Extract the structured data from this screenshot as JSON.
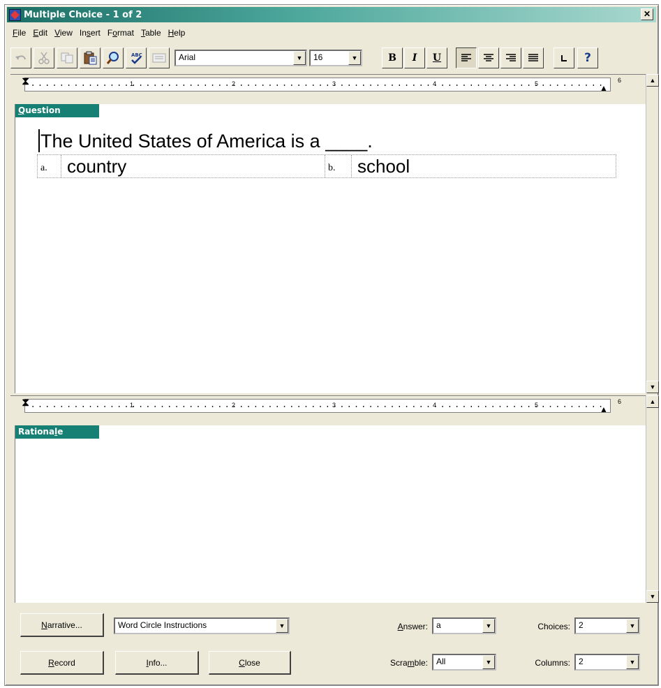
{
  "window": {
    "title": "Multiple Choice - 1 of 2",
    "close_glyph": "✕"
  },
  "menu": {
    "items": [
      {
        "ul": "F",
        "rest": "ile"
      },
      {
        "ul": "E",
        "rest": "dit"
      },
      {
        "ul": "V",
        "rest": "iew"
      },
      {
        "pre": "In",
        "ul": "s",
        "rest": "ert"
      },
      {
        "pre": "F",
        "ul": "o",
        "rest": "rmat"
      },
      {
        "ul": "T",
        "rest": "able"
      },
      {
        "ul": "H",
        "rest": "elp"
      }
    ]
  },
  "toolbar": {
    "font_name": "Arial",
    "font_size": "16",
    "bold": "B",
    "italic": "I",
    "underline": "U",
    "help": "?",
    "icons": [
      "undo-icon",
      "cut-icon",
      "copy-icon",
      "paste-icon",
      "find-icon",
      "spellcheck-icon",
      "insert-icon"
    ]
  },
  "ruler": {
    "numbers": [
      "1",
      "2",
      "3",
      "4",
      "5",
      "6"
    ]
  },
  "question": {
    "section_label_ul": "Q",
    "section_label_rest": "uestion",
    "text": "The United States of America is a ____.",
    "choices": [
      {
        "letter": "a.",
        "text": "country"
      },
      {
        "letter": "b.",
        "text": "school"
      }
    ]
  },
  "rationale": {
    "section_label_pre": "Rationa",
    "section_label_ul": "l",
    "section_label_rest": "e"
  },
  "controls": {
    "narrative_ul": "N",
    "narrative_rest": "arrative...",
    "narrative_select": "Word Circle Instructions",
    "record_ul": "R",
    "record_rest": "ecord",
    "info_ul": "I",
    "info_rest": "nfo...",
    "close_ul": "C",
    "close_rest": "lose",
    "answer_label_ul": "A",
    "answer_label_rest": "nswer:",
    "answer_value": "a",
    "scramble_label_pre": "Scra",
    "scramble_label_ul": "m",
    "scramble_label_rest": "ble:",
    "scramble_value": "All",
    "choices_label": "Choices:",
    "choices_value": "2",
    "columns_label": "Columns:",
    "columns_value": "2"
  }
}
